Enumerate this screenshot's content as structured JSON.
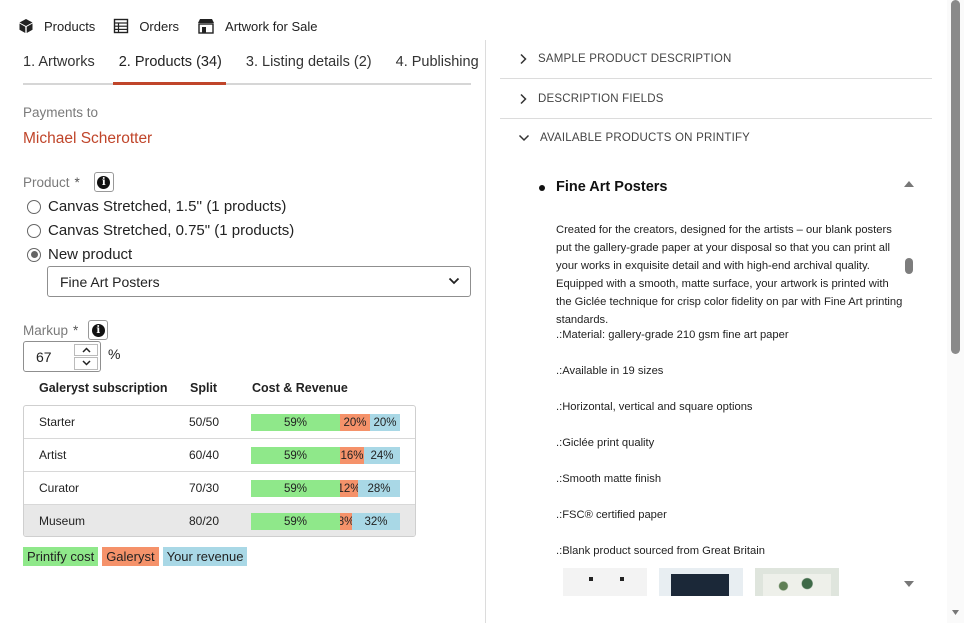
{
  "nav": {
    "items": [
      {
        "label": "Products",
        "icon": "box-icon"
      },
      {
        "label": "Orders",
        "icon": "table-icon"
      },
      {
        "label": "Artwork for Sale",
        "icon": "store-icon"
      }
    ]
  },
  "tabs": [
    {
      "label": "1. Artworks",
      "active": false
    },
    {
      "label": "2. Products (34)",
      "active": true
    },
    {
      "label": "3. Listing details (2)",
      "active": false
    },
    {
      "label": "4. Publishing",
      "active": false
    }
  ],
  "payments": {
    "label": "Payments to",
    "payee": "Michael Scherotter"
  },
  "product": {
    "label": "Product",
    "required_mark": "*",
    "options": [
      {
        "label": "Canvas Stretched, 1.5'' (1 products)",
        "checked": false
      },
      {
        "label": "Canvas Stretched, 0.75\" (1 products)",
        "checked": false
      },
      {
        "label": "New product",
        "checked": true
      }
    ],
    "selected_product": "Fine Art Posters"
  },
  "markup": {
    "label": "Markup",
    "required_mark": "*",
    "value": "67",
    "unit": "%"
  },
  "subscription_table": {
    "headers": {
      "name": "Galeryst subscription",
      "split": "Split",
      "cost": "Cost & Revenue"
    },
    "rows": [
      {
        "name": "Starter",
        "split": "50/50",
        "printify": 59,
        "galeryst": 20,
        "revenue": 20,
        "printify_label": "59%",
        "galeryst_label": "20%",
        "revenue_label": "20%"
      },
      {
        "name": "Artist",
        "split": "60/40",
        "printify": 59,
        "galeryst": 16,
        "revenue": 24,
        "printify_label": "59%",
        "galeryst_label": "16%",
        "revenue_label": "24%"
      },
      {
        "name": "Curator",
        "split": "70/30",
        "printify": 59,
        "galeryst": 12,
        "revenue": 28,
        "printify_label": "59%",
        "galeryst_label": "12%",
        "revenue_label": "28%"
      },
      {
        "name": "Museum",
        "split": "80/20",
        "printify": 59,
        "galeryst": 8,
        "revenue": 32,
        "printify_label": "59%",
        "galeryst_label": "8%",
        "revenue_label": "32%",
        "highlighted": true
      }
    ]
  },
  "legend": {
    "printify": "Printify cost",
    "galeryst": "Galeryst",
    "revenue": "Your revenue"
  },
  "colors": {
    "accent": "#c0452a",
    "printify": "#8fe88a",
    "galeryst": "#f5926a",
    "revenue": "#a9d8e6"
  },
  "accordion": [
    {
      "label": "SAMPLE PRODUCT DESCRIPTION",
      "expanded": false
    },
    {
      "label": "DESCRIPTION FIELDS",
      "expanded": false
    },
    {
      "label": "AVAILABLE PRODUCTS ON PRINTIFY",
      "expanded": true
    }
  ],
  "printify_product": {
    "title": "Fine Art Posters",
    "description": "Created for the creators, designed for the artists – our blank posters put the gallery-grade paper at your disposal so that you can print all your works in exquisite detail and with high-end archival quality. Equipped with a smooth, matte surface, your artwork is printed with the Giclée technique for crisp color fidelity on par with Fine Art printing standards.",
    "features": [
      ".:Material: gallery-grade 210 gsm fine art paper",
      ".:Available in 19 sizes",
      ".:Horizontal, vertical and square options",
      ".:Giclée print quality",
      ".:Smooth matte finish",
      ".:FSC® certified paper",
      ".:Blank product sourced from Great Britain"
    ]
  }
}
